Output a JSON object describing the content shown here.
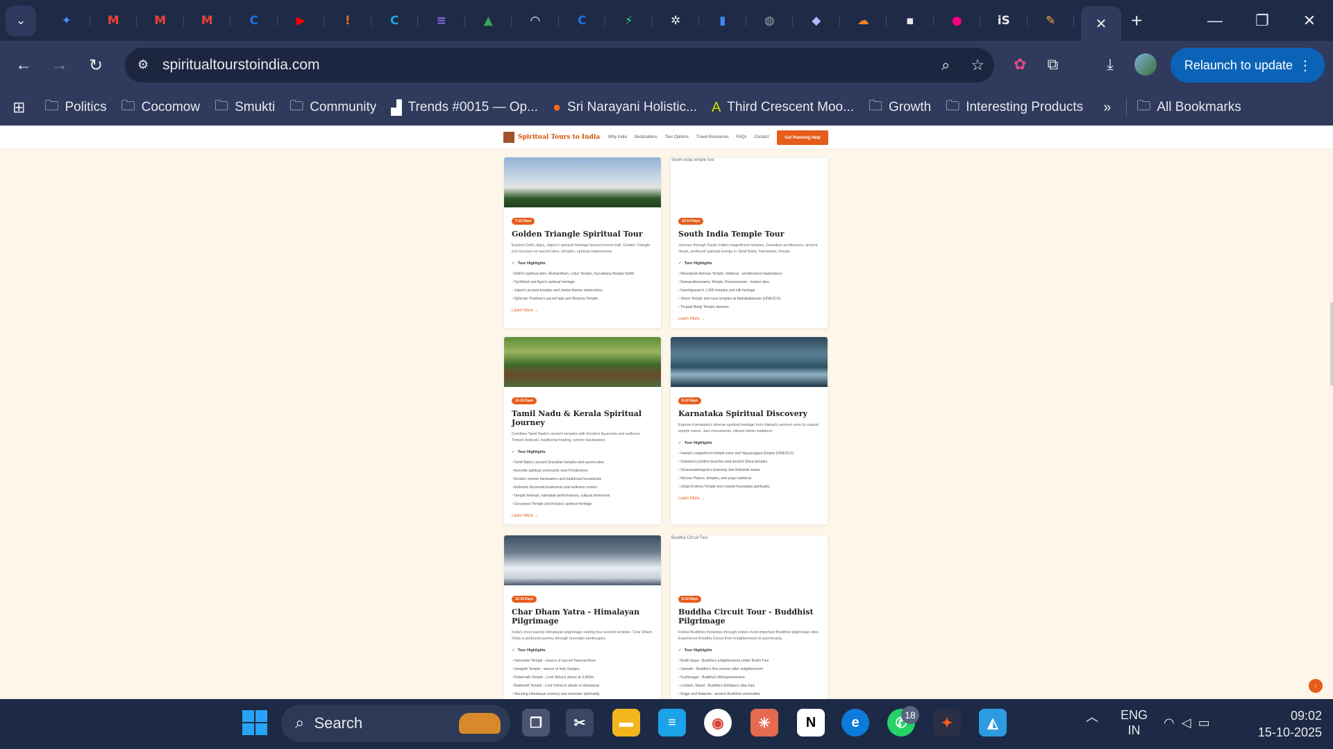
{
  "browser": {
    "url": "spiritualtourstoindia.com",
    "relaunch_label": "Relaunch to update",
    "tabs": [
      {
        "icon": "gemini-icon",
        "glyph": "✦",
        "color": "#4f8cf7"
      },
      {
        "icon": "gmail-icon",
        "glyph": "M",
        "color": "#ea4335"
      },
      {
        "icon": "gmail-icon",
        "glyph": "M",
        "color": "#ea4335"
      },
      {
        "icon": "gmail-icon",
        "glyph": "M",
        "color": "#ea4335"
      },
      {
        "icon": "c-icon",
        "glyph": "C",
        "color": "#1a73e8"
      },
      {
        "icon": "youtube-icon",
        "glyph": "▶",
        "color": "#ff0000"
      },
      {
        "icon": "info-icon",
        "glyph": "!",
        "color": "#f26b1d"
      },
      {
        "icon": "canva-icon",
        "glyph": "C",
        "color": "#1ea6e0"
      },
      {
        "icon": "docs-icon",
        "glyph": "≡",
        "color": "#8e6cf0"
      },
      {
        "icon": "drive-icon",
        "glyph": "▲",
        "color": "#34a853"
      },
      {
        "icon": "rainbow-icon",
        "glyph": "◠",
        "color": "#ffffff"
      },
      {
        "icon": "c-icon",
        "glyph": "C",
        "color": "#1a73e8"
      },
      {
        "icon": "bolt-icon",
        "glyph": "⚡",
        "color": "#2ecc71"
      },
      {
        "icon": "openai-icon",
        "glyph": "✲",
        "color": "#e8eaed"
      },
      {
        "icon": "chart-icon",
        "glyph": "▮",
        "color": "#4285f4"
      },
      {
        "icon": "globe-icon",
        "glyph": "◍",
        "color": "#9aa0a6"
      },
      {
        "icon": "diamond-icon",
        "glyph": "◆",
        "color": "#b0b8ff"
      },
      {
        "icon": "cloud-icon",
        "glyph": "☁",
        "color": "#f48120"
      },
      {
        "icon": "unsplash-icon",
        "glyph": "▪",
        "color": "#e8eaed"
      },
      {
        "icon": "flickr-icon",
        "glyph": "●",
        "color": "#ff0084"
      },
      {
        "icon": "is-icon",
        "glyph": "iS",
        "color": "#e8eaed"
      },
      {
        "icon": "pencil-icon",
        "glyph": "✎",
        "color": "#f2a93b"
      }
    ]
  },
  "bookmarks": [
    {
      "label": "Politics",
      "icon": "folder-icon"
    },
    {
      "label": "Cocomow",
      "icon": "folder-icon"
    },
    {
      "label": "Smukti",
      "icon": "folder-icon"
    },
    {
      "label": "Community",
      "icon": "folder-icon"
    },
    {
      "label": "Trends #0015 — Op...",
      "icon": "trends-icon"
    },
    {
      "label": "Sri Narayani Holistic...",
      "icon": "narayani-icon"
    },
    {
      "label": "Third Crescent Moo...",
      "icon": "a-icon"
    },
    {
      "label": "Growth",
      "icon": "folder-icon"
    },
    {
      "label": "Interesting Products",
      "icon": "folder-icon"
    }
  ],
  "all_bookmarks_label": "All Bookmarks",
  "site": {
    "logo_text": "Spiritual Tours to India",
    "nav": [
      "Why India",
      "Destinations",
      "Tour Options",
      "Travel Resources",
      "FAQs",
      "Contact"
    ],
    "cta": "Get Planning Help",
    "highlights_label": "Tour Highlights",
    "learn_more": "Learn More →",
    "cards": [
      {
        "days": "7-10 Days",
        "title": "Golden Triangle Spiritual Tour",
        "desc": "Explore Delhi, Agra, Jaipur's spiritual heritage beyond tourist trail. Golden Triangle tour focuses on sacred sites, temples, spiritual experiences.",
        "image_alt": "",
        "image": "taj",
        "highlights": [
          "Delhi's spiritual sites: Akshardham, Lotus Temple, Gurudwara Bangla Sahib",
          "Taj Mahal and Agra's spiritual heritage",
          "Jaipur's ancient temples and Jantar Mantar observatory",
          "Optional: Pushkar's sacred lake and Brahma Temple"
        ]
      },
      {
        "days": "10-14 Days",
        "title": "South India Temple Tour",
        "desc": "Journey through South India's magnificent temples, Dravidian architecture, ancient rituals, profound spiritual energy in Tamil Nadu, Karnataka, Kerala.",
        "image_alt": "South India temple tour",
        "image": "",
        "highlights": [
          "Meenakshi Amman Temple, Madurai - architectural masterpiece",
          "Ramanathaswamy Temple, Rameswaram - holiest sites",
          "Kanchipuram's 1,000 temples and silk heritage",
          "Shore Temple and cave temples at Mahabalipuram (UNESCO)",
          "Tirupati Balaji Temple darshan"
        ]
      },
      {
        "days": "12-15 Days",
        "title": "Tamil Nadu & Kerala Spiritual Journey",
        "desc": "Combine Tamil Nadu's ancient temples with Kerala's Ayurveda and wellness. Temple festivals, traditional healing, serene backwaters.",
        "image_alt": "",
        "image": "kerala",
        "highlights": [
          "Tamil Nadu's ancient Dravidian temples and sacred sites",
          "Auroville spiritual community near Pondicherry",
          "Kerala's serene backwaters and traditional houseboats",
          "Authentic Ayurveda treatments and wellness centers",
          "Temple festivals, kathakali performances, cultural immersion",
          "Guruvayur Temple and Kerala's spiritual heritage"
        ]
      },
      {
        "days": "8-10 Days",
        "title": "Karnataka Spiritual Discovery",
        "desc": "Explore Karnataka's diverse spiritual heritage from Hampi's ancient ruins to coastal temple towns. Jain monuments, vibrant Hindu traditions.",
        "image_alt": "",
        "image": "forest",
        "highlights": [
          "Hampi's magnificent temple ruins and Vijayanagara Empire (UNESCO)",
          "Gokarna's pristine beaches and ancient Shiva temples",
          "Shravanabelagola's towering Jain Bahubali statue",
          "Mysore Palace, temples, and yoga traditions",
          "Udupi Krishna Temple and coastal Karnataka spirituality"
        ]
      },
      {
        "days": "12-14 Days",
        "title": "Char Dham Yatra - Himalayan Pilgrimage",
        "desc": "India's most sacred Himalayan pilgrimage visiting four ancient temples. Char Dham Yatra is profound journey through mountain landscapes.",
        "image_alt": "",
        "image": "snow",
        "highlights": [
          "Yamunotri Temple - source of sacred Yamuna River",
          "Gangotri Temple - source of holy Ganges",
          "Kedarnath Temple - Lord Shiva's shrine at 3,583m",
          "Badrinath Temple - Lord Vishnu's abode in Himalayas",
          "Stunning Himalayan scenery and mountain spirituality"
        ]
      },
      {
        "days": "8-10 Days",
        "title": "Buddha Circuit Tour - Buddhist Pilgrimage",
        "desc": "Follow Buddha's footsteps through India's most important Buddhist pilgrimage sites. Experience Buddha Circuit from enlightenment to parinirvana.",
        "image_alt": "Buddha Circuit Tour",
        "image": "",
        "highlights": [
          "Bodh Gaya - Buddha's enlightenment under Bodhi Tree",
          "Sarnath - Buddha's first sermon after enlightenment",
          "Kushinagar - Buddha's Mahaparinirvana",
          "Lumbini, Nepal - Buddha's birthplace (day trip)",
          "Rajgir and Nalanda - ancient Buddhist universities"
        ]
      }
    ]
  },
  "taskbar": {
    "search_label": "Search",
    "whatsapp_badge": "18",
    "lang_top": "ENG",
    "lang_bottom": "IN",
    "time": "09:02",
    "date": "15-10-2025"
  }
}
